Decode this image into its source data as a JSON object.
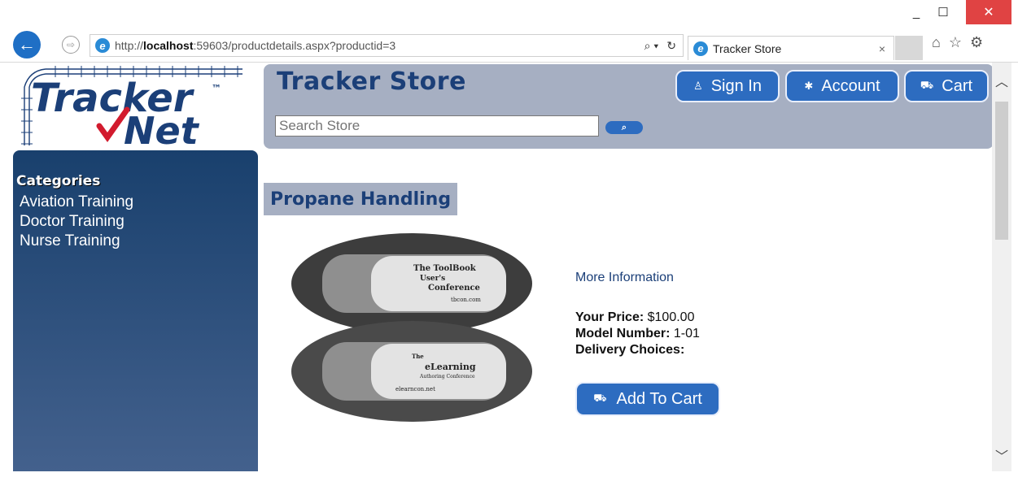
{
  "browser": {
    "window_controls": {
      "minimize": "_",
      "maximize": "☐",
      "close": "✕"
    },
    "url_prefix": "http://",
    "url_host": "localhost",
    "url_rest": ":59603/productdetails.aspx?productid=3",
    "tab_title": "Tracker Store",
    "tab_close": "×",
    "icons": [
      "home-icon",
      "favorites-star-icon",
      "settings-gear-icon"
    ]
  },
  "logo": {
    "line1": "Tracker",
    "tm": "™",
    "line2": "Net"
  },
  "header": {
    "store_title": "Tracker Store",
    "buttons": [
      {
        "label": "Sign In",
        "icon": "user-icon"
      },
      {
        "label": "Account",
        "icon": "gear-icon"
      },
      {
        "label": "Cart",
        "icon": "cart-icon"
      }
    ],
    "search_placeholder": "Search Store"
  },
  "sidebar": {
    "heading": "Categories",
    "items": [
      "Aviation Training",
      "Doctor Training",
      "Nurse Training"
    ]
  },
  "product": {
    "title": "Propane Handling",
    "more_info": "More Information",
    "price_label": "Your Price:",
    "price_value": "$100.00",
    "model_label": "Model Number:",
    "model_value": "1-01",
    "delivery_label": "Delivery Choices:",
    "add_to_cart": "Add To Cart",
    "image_text": {
      "top": [
        "The ToolBook",
        "User's",
        "Conference",
        "tbcon.com"
      ],
      "bottom": [
        "The",
        "eLearning",
        "Authoring Conference",
        "elearncon.net"
      ]
    }
  },
  "colors": {
    "accent": "#2d6cc0",
    "navy": "#1b3f78",
    "header_bg": "#a6afc2",
    "sidebar_top": "#19406d",
    "sidebar_bottom": "#46638f"
  }
}
